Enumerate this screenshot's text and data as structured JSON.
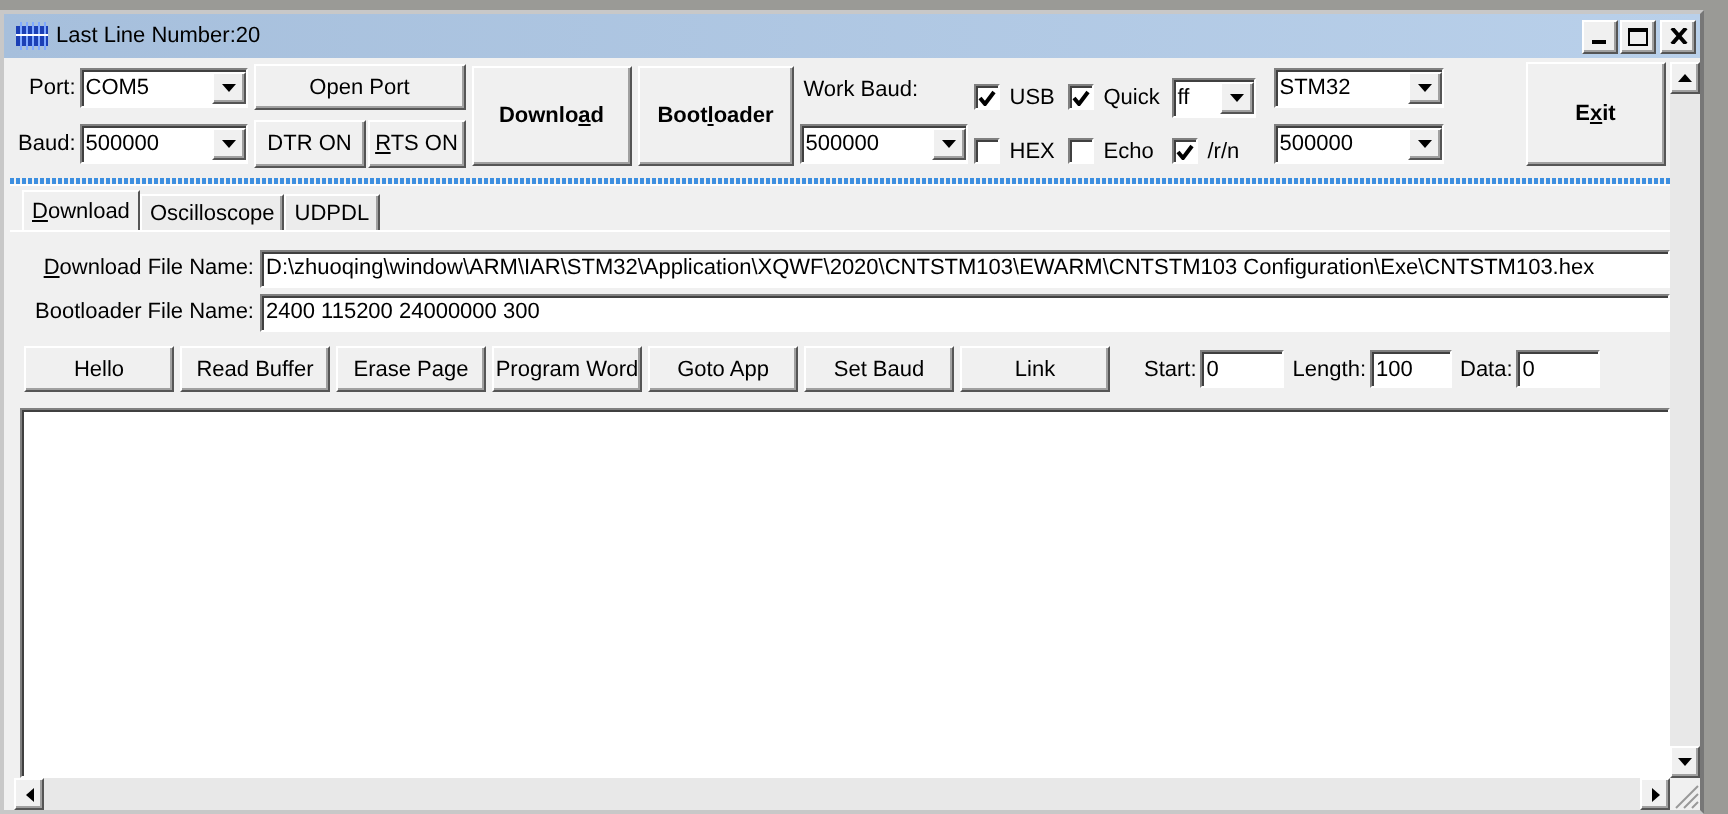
{
  "window": {
    "title": "Last Line Number:20"
  },
  "port": {
    "label": "Port:",
    "value": "COM5"
  },
  "baud": {
    "label": "Baud:",
    "value": "500000"
  },
  "open_port": {
    "label": "Open Port"
  },
  "dtr": {
    "label": "DTR ON"
  },
  "rts": {
    "label": "RTS ON"
  },
  "download": {
    "label": "Download"
  },
  "bootloader": {
    "label": "Bootloader"
  },
  "work_baud": {
    "label": "Work Baud:",
    "value": "500000"
  },
  "checks": [
    {
      "label": "USB",
      "checked": true
    },
    {
      "label": "Quick",
      "checked": true
    },
    {
      "label": "HEX",
      "checked": false
    },
    {
      "label": "Echo",
      "checked": false
    },
    {
      "label": "/r/n",
      "checked": true
    }
  ],
  "quick_value": "ff",
  "chip": "STM32",
  "chip_baud": "500000",
  "exit": {
    "label": "Exit"
  },
  "tabs": [
    {
      "label": "Download",
      "selected": true
    },
    {
      "label": "Oscilloscope",
      "selected": false
    },
    {
      "label": "UDPDL",
      "selected": false
    }
  ],
  "download_file": {
    "label": "Download File Name:",
    "value": "D:\\zhuoqing\\window\\ARM\\IAR\\STM32\\Application\\XQWF\\2020\\CNTSTM103\\EWARM\\CNTSTM103 Configuration\\Exe\\CNTSTM103.hex"
  },
  "bootloader_file": {
    "label": "Bootloader File Name:",
    "value": "2400 115200 24000000 300"
  },
  "commands": [
    "Hello",
    "Read Buffer",
    "Erase Page",
    "Program Word",
    "Goto App",
    "Set Baud",
    "Link"
  ],
  "params": [
    {
      "label": "Start:",
      "value": "0"
    },
    {
      "label": "Length:",
      "value": "100"
    },
    {
      "label": "Data:",
      "value": "0"
    }
  ]
}
